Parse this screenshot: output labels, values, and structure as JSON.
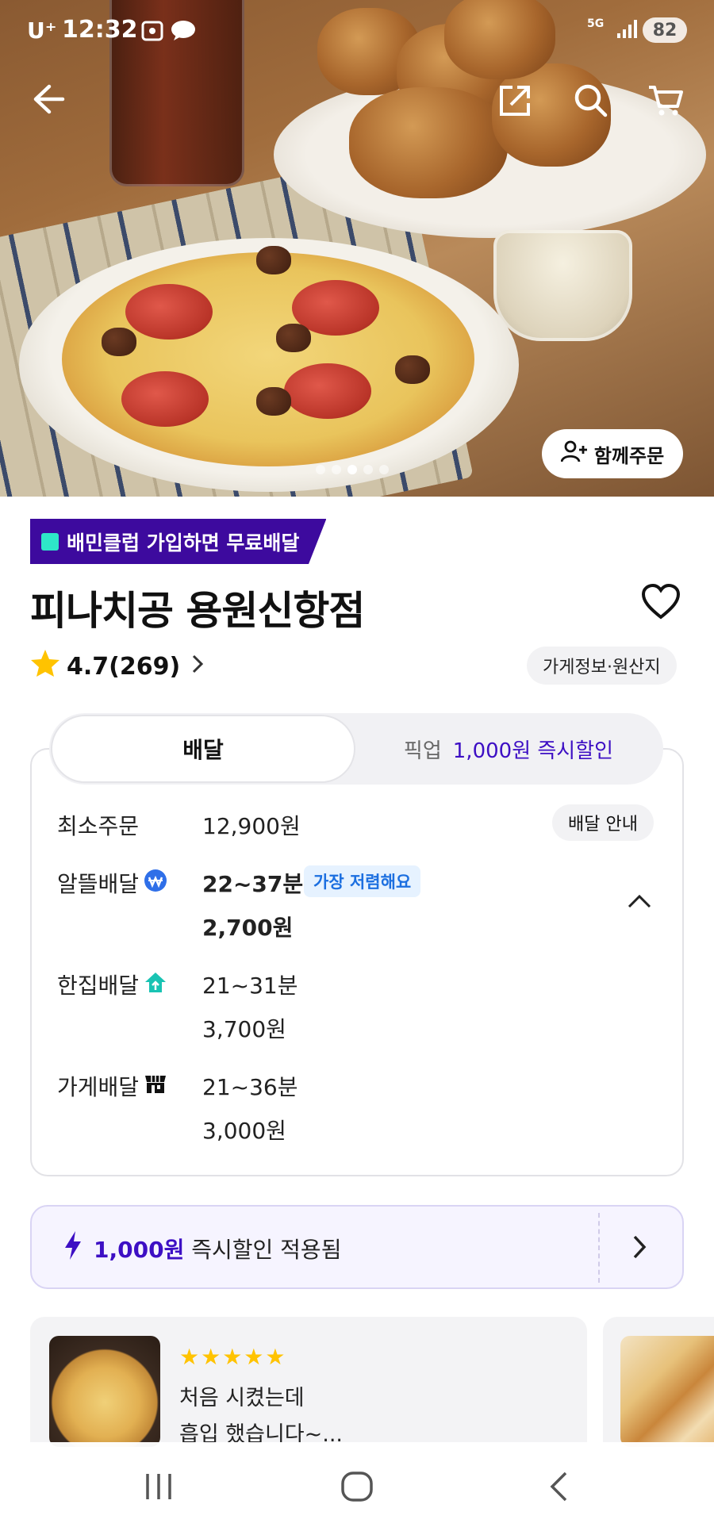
{
  "status_bar": {
    "carrier": "U⁺",
    "time": "12:32",
    "network": "5G",
    "battery": "82"
  },
  "hero": {
    "group_order_label": "함께주문",
    "pager": {
      "count": 5,
      "active_index": 2
    }
  },
  "store": {
    "club_badge": "배민클럽 가입하면 무료배달",
    "name": "피나치공 용원신항점",
    "rating": "4.7",
    "review_count": "(269)",
    "info_chip": "가게정보·원산지"
  },
  "tabs": {
    "delivery": "배달",
    "pickup": "픽업",
    "pickup_discount": "1,000원 즉시할인"
  },
  "delivery": {
    "min_order_label": "최소주문",
    "min_order_value": "12,900원",
    "guide_chip": "배달 안내",
    "options": [
      {
        "label": "알뜰배달",
        "time": "22~37분",
        "fee": "2,700원",
        "tag": "가장 저렴해요",
        "icon": "saver-badge-icon"
      },
      {
        "label": "한집배달",
        "time": "21~31분",
        "fee": "3,700원",
        "icon": "house-icon"
      },
      {
        "label": "가게배달",
        "time": "21~36분",
        "fee": "3,000원",
        "icon": "store-icon"
      }
    ]
  },
  "discount_banner": {
    "amount": "1,000원",
    "text": " 즉시할인 적용됨"
  },
  "reviews": [
    {
      "stars": "★★★★★",
      "line1": "처음 시켰는데",
      "line2": "흡입 했습니다~..."
    }
  ],
  "colors": {
    "brand_purple": "#3d0fc4",
    "club_bg": "#3d0a9e",
    "star": "#ffc300",
    "mint": "#2ee6c8"
  }
}
